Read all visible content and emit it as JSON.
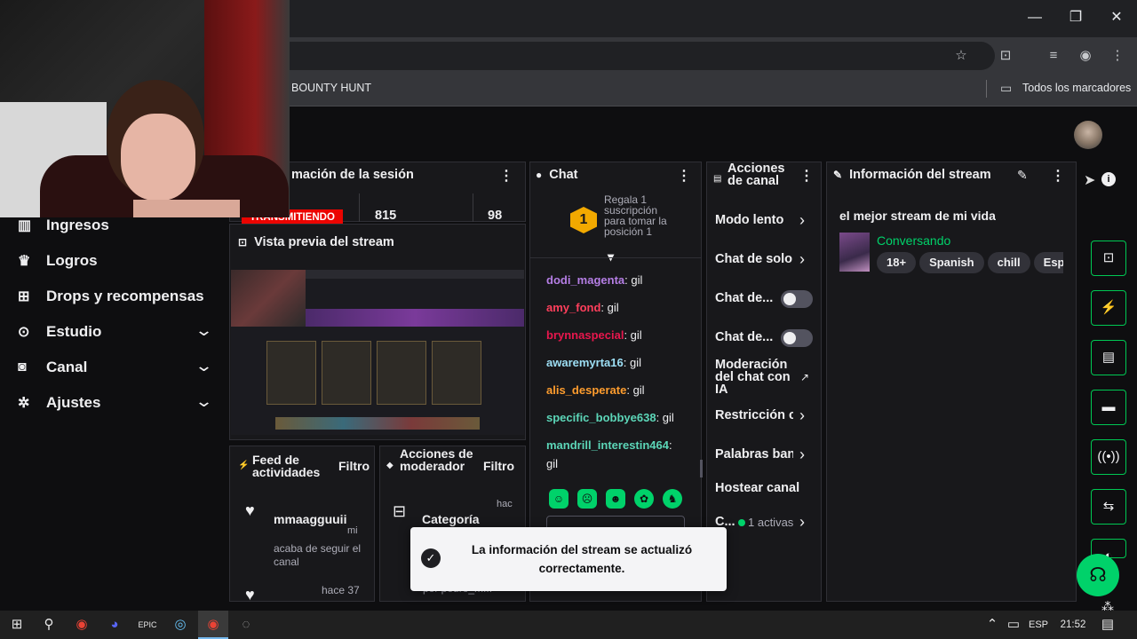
{
  "browser": {
    "bookmark_item": "BOUNTY HUNT",
    "all_bookmarks": "Todos los marcadores",
    "win_minimize": "—",
    "win_restore": "❐",
    "win_close": "✕"
  },
  "session": {
    "title": "mación de la sesión",
    "live_badge": "TRANSMITIENDO",
    "stat1": "815",
    "stat2": "98"
  },
  "sidebar": {
    "items": [
      {
        "label": "Ingresos",
        "icon": "bar-chart-icon"
      },
      {
        "label": "Logros",
        "icon": "trophy-icon"
      },
      {
        "label": "Drops y recompensas",
        "icon": "gift-icon"
      },
      {
        "label": "Estudio",
        "icon": "studio-icon"
      },
      {
        "label": "Canal",
        "icon": "camera-icon"
      },
      {
        "label": "Ajustes",
        "icon": "gear-icon"
      }
    ]
  },
  "preview": {
    "title": "Vista previa del stream"
  },
  "feed": {
    "title": "Feed de actividades",
    "filter": "Filtro",
    "user": "mmaagguuii",
    "time_unit": "mi",
    "action": "acaba de seguir el canal",
    "time2": "hace 37"
  },
  "modactions": {
    "title": "Acciones de moderador",
    "filter": "Filtro",
    "item": "Categoría",
    "time": "hac",
    "by": "por pedro_m..."
  },
  "chat": {
    "title": "Chat",
    "sub_text": "Regala 1 suscripción para tomar la posición 1",
    "badge": "1",
    "messages": [
      {
        "user": "dodi_magenta",
        "text": ": gil",
        "color": "#b57ee5"
      },
      {
        "user": "amy_fond",
        "text": ": gil",
        "color": "#ff3f5c"
      },
      {
        "user": "brynnaspecial",
        "text": ": gil",
        "color": "#e8174d"
      },
      {
        "user": "awaremyrta16",
        "text": ": gil",
        "color": "#9ddff5"
      },
      {
        "user": "alis_desperate",
        "text": ": gil",
        "color": "#ff9d2e"
      },
      {
        "user": "specific_bobbye638",
        "text": ": gil",
        "color": "#5cd6b8"
      },
      {
        "user": "mandrill_interestin464",
        "text": ":",
        "color": "#5cd6b8"
      }
    ],
    "last_text": "gil"
  },
  "channel_actions": {
    "title": "Acciones de canal",
    "items": [
      {
        "label": "Modo lento"
      },
      {
        "label": "Chat de solo"
      },
      {
        "label": "Chat de..."
      },
      {
        "label": "Chat de..."
      },
      {
        "label": "Moderación del chat con IA"
      },
      {
        "label": "Restricción c"
      },
      {
        "label": "Palabras ban"
      },
      {
        "label": "Hostear canal"
      },
      {
        "label": "C..."
      }
    ],
    "active_count": "1 activas"
  },
  "stream_info": {
    "title": "Información del stream",
    "stream_title": "el mejor stream de mi vida",
    "category": "Conversando",
    "tags": [
      "18+",
      "Spanish",
      "chill",
      "Españo"
    ]
  },
  "toast": {
    "message": "La información del stream se actualizó correctamente."
  },
  "taskbar": {
    "lang": "ESP",
    "time": "21:52"
  },
  "colors": {
    "accent_green": "#00d26a",
    "live_red": "#eb0400",
    "bg": "#0e0e10",
    "panel": "#18181b"
  }
}
